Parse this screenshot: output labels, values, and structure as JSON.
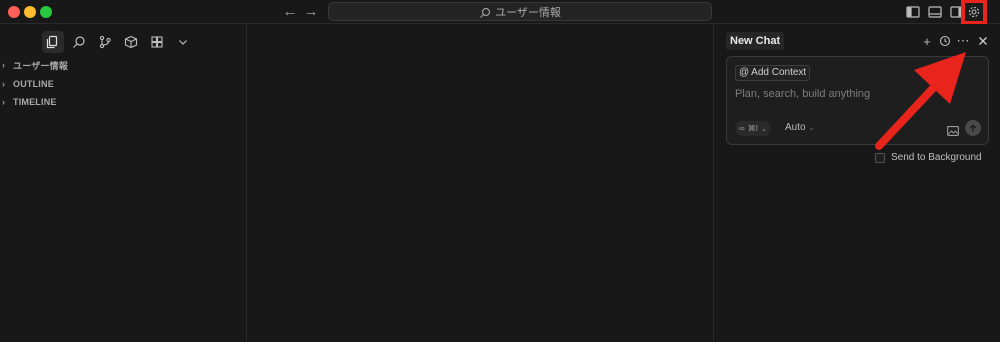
{
  "window": {
    "command_center": {
      "text": "ユーザー情報",
      "icon": "search-icon"
    }
  },
  "sidebar": {
    "activity_icons": [
      "files-icon",
      "search-icon",
      "source-control-icon",
      "package-icon",
      "extensions-icon",
      "chevron-down-icon"
    ],
    "sections": [
      {
        "label": "ユーザー情報"
      },
      {
        "label": "OUTLINE"
      },
      {
        "label": "TIMELINE"
      }
    ]
  },
  "chat": {
    "tab_label": "New Chat",
    "add_context": "Add Context",
    "add_context_prefix": "@",
    "placeholder": "Plan, search, build anything",
    "mode_shortcut": "⌘I",
    "model": "Auto",
    "send_to_background": "Send to Background"
  },
  "colors": {
    "background": "#181818",
    "annotation_red": "#e8241c"
  }
}
